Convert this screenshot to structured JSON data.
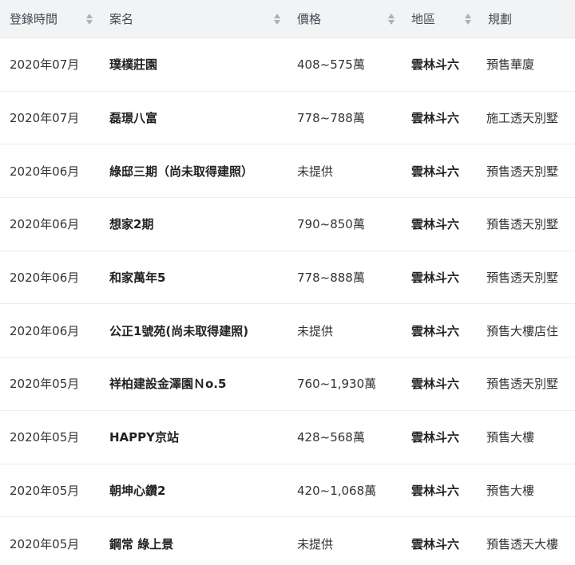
{
  "columns": [
    {
      "label": "登錄時間",
      "sortable": true
    },
    {
      "label": "案名",
      "sortable": true
    },
    {
      "label": "價格",
      "sortable": true
    },
    {
      "label": "地區",
      "sortable": true
    },
    {
      "label": "規劃",
      "sortable": false
    }
  ],
  "rows": [
    {
      "date": "2020年07月",
      "name": "璞樸莊園",
      "price": "408~575萬",
      "area": "雲林斗六",
      "plan": "預售華廈"
    },
    {
      "date": "2020年07月",
      "name": "磊璟八富",
      "price": "778~788萬",
      "area": "雲林斗六",
      "plan": "施工透天別墅"
    },
    {
      "date": "2020年06月",
      "name": "綠邸三期（尚未取得建照）",
      "price": "未提供",
      "area": "雲林斗六",
      "plan": "預售透天別墅"
    },
    {
      "date": "2020年06月",
      "name": "想家2期",
      "price": "790~850萬",
      "area": "雲林斗六",
      "plan": "預售透天別墅"
    },
    {
      "date": "2020年06月",
      "name": "和家萬年5",
      "price": "778~888萬",
      "area": "雲林斗六",
      "plan": "預售透天別墅"
    },
    {
      "date": "2020年06月",
      "name": "公正1號苑(尚未取得建照)",
      "price": "未提供",
      "area": "雲林斗六",
      "plan": "預售大樓店住"
    },
    {
      "date": "2020年05月",
      "name": "祥柏建設金澤園Ｎo.5",
      "price": "760~1,930萬",
      "area": "雲林斗六",
      "plan": "預售透天別墅"
    },
    {
      "date": "2020年05月",
      "name": "HAPPY京站",
      "price": "428~568萬",
      "area": "雲林斗六",
      "plan": "預售大樓"
    },
    {
      "date": "2020年05月",
      "name": "朝坤心鑽2",
      "price": "420~1,068萬",
      "area": "雲林斗六",
      "plan": "預售大樓"
    },
    {
      "date": "2020年05月",
      "name": "鋼常 綠上景",
      "price": "未提供",
      "area": "雲林斗六",
      "plan": "預售透天大樓"
    }
  ]
}
